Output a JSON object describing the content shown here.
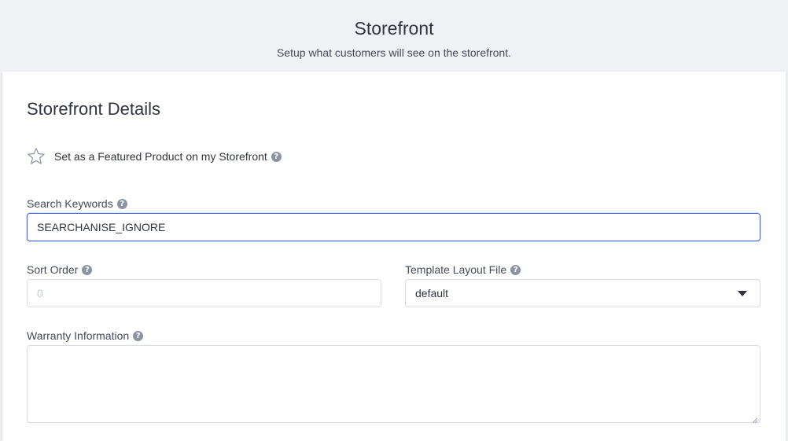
{
  "header": {
    "title": "Storefront",
    "subtitle": "Setup what customers will see on the storefront."
  },
  "card": {
    "title": "Storefront Details",
    "featured": {
      "label": "Set as a Featured Product on my Storefront",
      "icon": "star-outline-icon",
      "checked": false
    },
    "search_keywords": {
      "label": "Search Keywords",
      "value": "SEARCHANISE_IGNORE"
    },
    "sort_order": {
      "label": "Sort Order",
      "placeholder": "0",
      "value": ""
    },
    "template_layout": {
      "label": "Template Layout File",
      "selected": "default"
    },
    "warranty": {
      "label": "Warranty Information",
      "value": ""
    }
  },
  "help_glyph": "?",
  "colors": {
    "background": "#f0f1f4",
    "card": "#ffffff",
    "focus_border": "#3c64f4",
    "input_border": "#d9dce9",
    "help_icon": "#8c93a1"
  }
}
